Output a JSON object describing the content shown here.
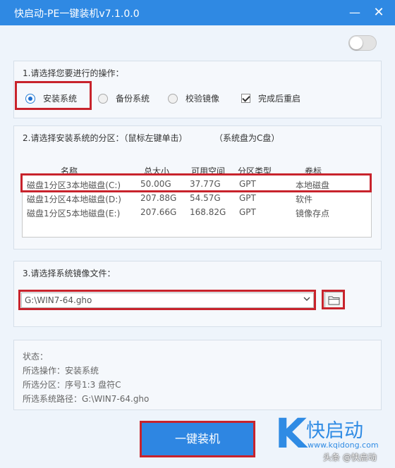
{
  "window": {
    "title": "快启动-PE一键装机v7.1.0.0",
    "minimize_glyph": "—",
    "close_glyph": "✕"
  },
  "toggle": {
    "on": false
  },
  "section1": {
    "title": "1.请选择您要进行的操作：",
    "options": [
      {
        "label": "安装系统",
        "checked": true
      },
      {
        "label": "备份系统",
        "checked": false
      },
      {
        "label": "校验镜像",
        "checked": false
      }
    ],
    "restart": {
      "label": "完成后重启",
      "checked": true
    }
  },
  "section2": {
    "title": "2.请选择安装系统的分区：（鼠标左键单击）",
    "note": "（系统盘为C盘）",
    "columns": [
      "名称",
      "总大小",
      "可用空间",
      "分区类型",
      "卷标"
    ],
    "rows": [
      [
        "磁盘1分区3本地磁盘(C:)",
        "50.00G",
        "37.77G",
        "GPT",
        "本地磁盘"
      ],
      [
        "磁盘1分区4本地磁盘(D:)",
        "207.88G",
        "54.57G",
        "GPT",
        "软件"
      ],
      [
        "磁盘1分区5本地磁盘(E:)",
        "207.66G",
        "168.82G",
        "GPT",
        "镜像存点"
      ]
    ]
  },
  "section3": {
    "title": "3.请选择系统镜像文件：",
    "image_path": "G:\\WIN7-64.gho"
  },
  "status": {
    "label": "状态：",
    "operation": "所选操作：安装系统",
    "partition": "所选分区：序号1:3    盘符C",
    "image": "所选系统路径：G:\\WIN7-64.gho"
  },
  "install_button": "一键装机",
  "brand": {
    "letter": "K",
    "name": "快启动",
    "url": "www.kqidong.com",
    "watermark": "头条 @快启动"
  },
  "colors": {
    "titlebar": "#2f89e3",
    "highlight_border": "#c8232c",
    "button": "#2e86e2",
    "brand": "#2f8be4"
  }
}
